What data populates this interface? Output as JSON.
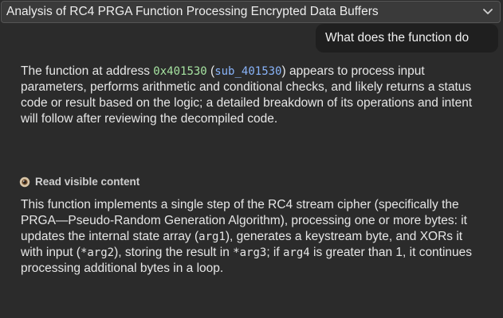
{
  "header": {
    "title": "Analysis of RC4 PRGA Function Processing Encrypted Data Buffers"
  },
  "user_message": "What does the function do",
  "response": {
    "p1_a": "The function at address ",
    "p1_addr": "0x401530",
    "p1_b": " (",
    "p1_sub": "sub_401530",
    "p1_c": ") appears to process input parameters, performs arithmetic and conditional checks, and likely returns a status code or result based on the logic; a detailed breakdown of its operations and intent will follow after reviewing the decompiled code."
  },
  "tool_call": {
    "icon": "eye-icon",
    "label": "Read visible content"
  },
  "answer": {
    "a": "This function implements a single step of the RC4 stream cipher (specifically the PRGA—Pseudo-Random Generation Algorithm), processing one or more bytes: it updates the internal state array (",
    "arg1": "arg1",
    "b": "), generates a keystream byte, and XORs it with input (",
    "arg2": "*arg2",
    "c": "), storing the result in ",
    "arg3": "*arg3",
    "d": "; if ",
    "arg4": "arg4",
    "e": " is greater than 1, it continues processing additional bytes in a loop."
  },
  "colors": {
    "background": "#2b2b2b",
    "address": "#a6e3a1",
    "symbol": "#89b4fa"
  }
}
